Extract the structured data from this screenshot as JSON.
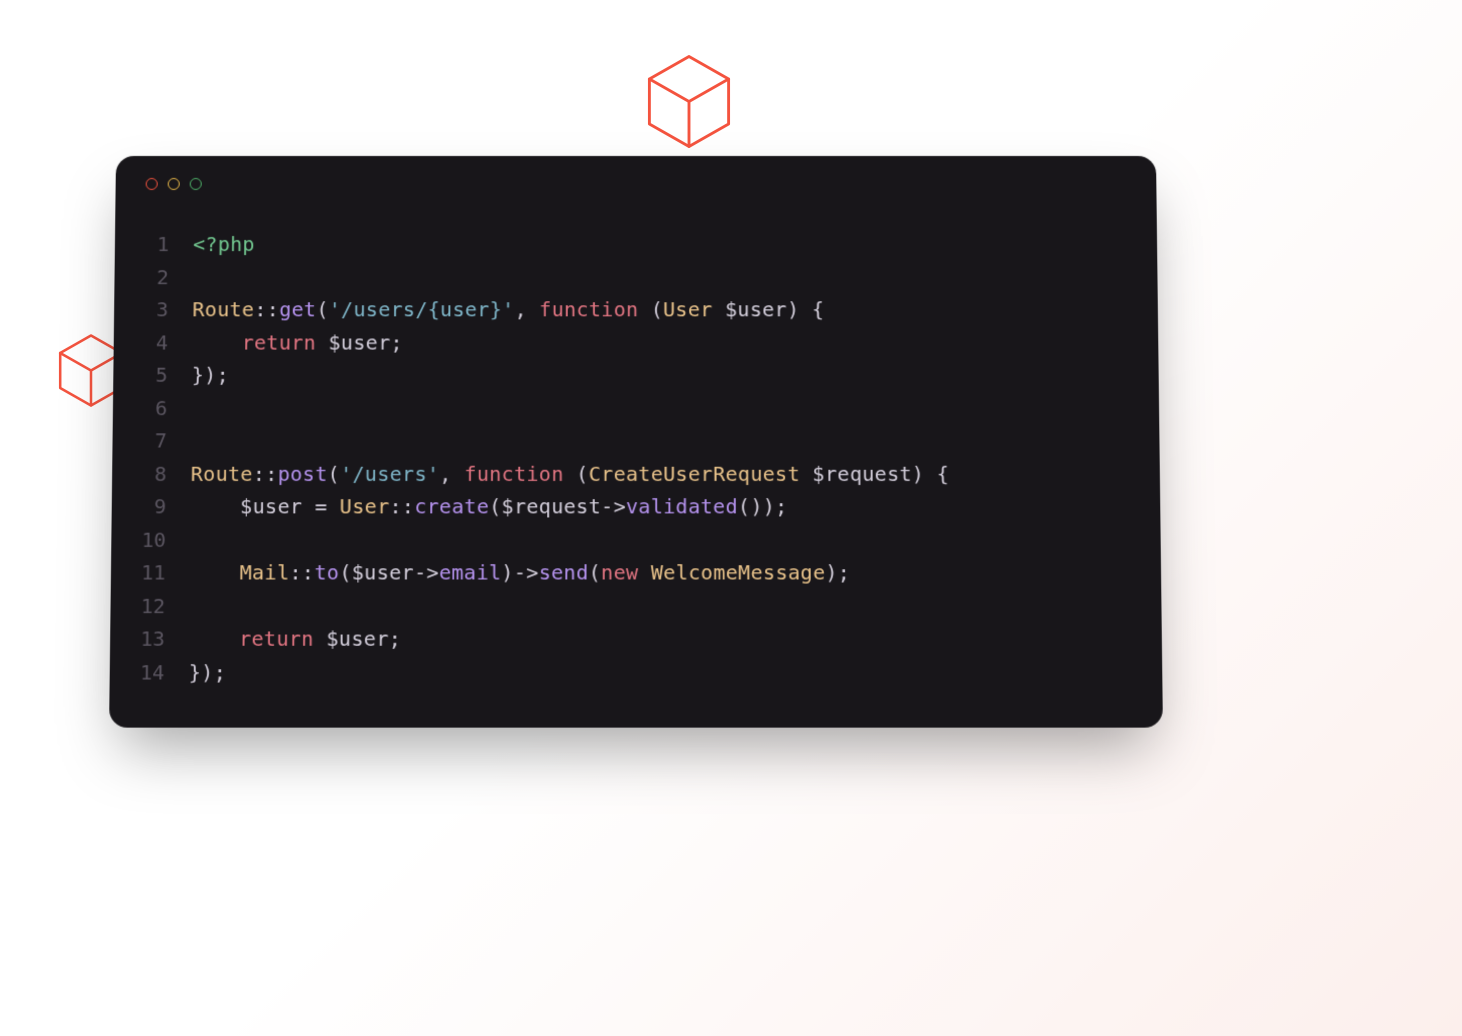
{
  "decorations": {
    "cube_top": "cube-icon",
    "cube_left": "cube-icon"
  },
  "editor": {
    "window_dots": [
      "red",
      "yellow",
      "green"
    ],
    "language": "php",
    "lines": [
      {
        "n": "1",
        "tokens": [
          {
            "c": "c-tag",
            "t": "<?php"
          }
        ]
      },
      {
        "n": "2",
        "tokens": []
      },
      {
        "n": "3",
        "tokens": [
          {
            "c": "c-class",
            "t": "Route"
          },
          {
            "c": "c-op",
            "t": "::"
          },
          {
            "c": "c-method",
            "t": "get"
          },
          {
            "c": "c-paren",
            "t": "("
          },
          {
            "c": "c-string",
            "t": "'/users/{user}'"
          },
          {
            "c": "c-comma",
            "t": ", "
          },
          {
            "c": "c-keyword",
            "t": "function"
          },
          {
            "c": "c-paren",
            "t": " ("
          },
          {
            "c": "c-type",
            "t": "User "
          },
          {
            "c": "c-var",
            "t": "$user"
          },
          {
            "c": "c-paren",
            "t": ") {"
          }
        ]
      },
      {
        "n": "4",
        "tokens": [
          {
            "c": "c-var",
            "t": "    "
          },
          {
            "c": "c-keyword",
            "t": "return"
          },
          {
            "c": "c-var",
            "t": " $user"
          },
          {
            "c": "c-punct",
            "t": ";"
          }
        ]
      },
      {
        "n": "5",
        "tokens": [
          {
            "c": "c-paren",
            "t": "});"
          }
        ]
      },
      {
        "n": "6",
        "tokens": []
      },
      {
        "n": "7",
        "tokens": []
      },
      {
        "n": "8",
        "tokens": [
          {
            "c": "c-class",
            "t": "Route"
          },
          {
            "c": "c-op",
            "t": "::"
          },
          {
            "c": "c-method",
            "t": "post"
          },
          {
            "c": "c-paren",
            "t": "("
          },
          {
            "c": "c-string",
            "t": "'/users'"
          },
          {
            "c": "c-comma",
            "t": ", "
          },
          {
            "c": "c-keyword",
            "t": "function"
          },
          {
            "c": "c-paren",
            "t": " ("
          },
          {
            "c": "c-type",
            "t": "CreateUserRequest "
          },
          {
            "c": "c-var",
            "t": "$request"
          },
          {
            "c": "c-paren",
            "t": ") {"
          }
        ]
      },
      {
        "n": "9",
        "tokens": [
          {
            "c": "c-var",
            "t": "    $user "
          },
          {
            "c": "c-op",
            "t": "= "
          },
          {
            "c": "c-class",
            "t": "User"
          },
          {
            "c": "c-op",
            "t": "::"
          },
          {
            "c": "c-method",
            "t": "create"
          },
          {
            "c": "c-paren",
            "t": "("
          },
          {
            "c": "c-var",
            "t": "$request"
          },
          {
            "c": "c-arrow",
            "t": "->"
          },
          {
            "c": "c-method",
            "t": "validated"
          },
          {
            "c": "c-paren",
            "t": "());"
          }
        ]
      },
      {
        "n": "10",
        "tokens": []
      },
      {
        "n": "11",
        "tokens": [
          {
            "c": "c-var",
            "t": "    "
          },
          {
            "c": "c-class",
            "t": "Mail"
          },
          {
            "c": "c-op",
            "t": "::"
          },
          {
            "c": "c-method",
            "t": "to"
          },
          {
            "c": "c-paren",
            "t": "("
          },
          {
            "c": "c-var",
            "t": "$user"
          },
          {
            "c": "c-arrow",
            "t": "->"
          },
          {
            "c": "c-method",
            "t": "email"
          },
          {
            "c": "c-paren",
            "t": ")"
          },
          {
            "c": "c-arrow",
            "t": "->"
          },
          {
            "c": "c-method",
            "t": "send"
          },
          {
            "c": "c-paren",
            "t": "("
          },
          {
            "c": "c-keyword",
            "t": "new"
          },
          {
            "c": "c-type",
            "t": " WelcomeMessage"
          },
          {
            "c": "c-paren",
            "t": ");"
          }
        ]
      },
      {
        "n": "12",
        "tokens": []
      },
      {
        "n": "13",
        "tokens": [
          {
            "c": "c-var",
            "t": "    "
          },
          {
            "c": "c-keyword",
            "t": "return"
          },
          {
            "c": "c-var",
            "t": " $user"
          },
          {
            "c": "c-punct",
            "t": ";"
          }
        ]
      },
      {
        "n": "14",
        "tokens": [
          {
            "c": "c-paren",
            "t": "});"
          }
        ]
      }
    ]
  }
}
